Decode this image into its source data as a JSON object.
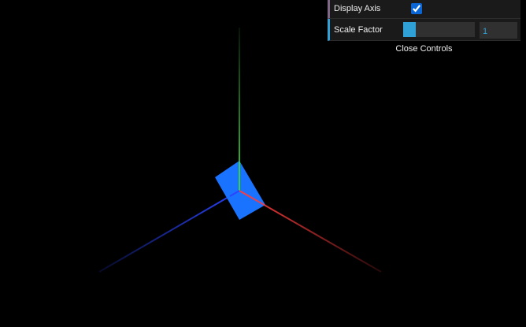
{
  "scene": {
    "background": "#000000",
    "axes": {
      "visible": true,
      "colors": {
        "x": "#ff3b3b",
        "y": "#3ad13a",
        "z": "#2a44ff"
      }
    },
    "cube": {
      "color": "#1a73ff"
    }
  },
  "controls": {
    "display_axis": {
      "label": "Display Axis",
      "checked": true
    },
    "scale_factor": {
      "label": "Scale Factor",
      "value": "1",
      "fraction": 0.18
    },
    "close_label": "Close Controls"
  }
}
